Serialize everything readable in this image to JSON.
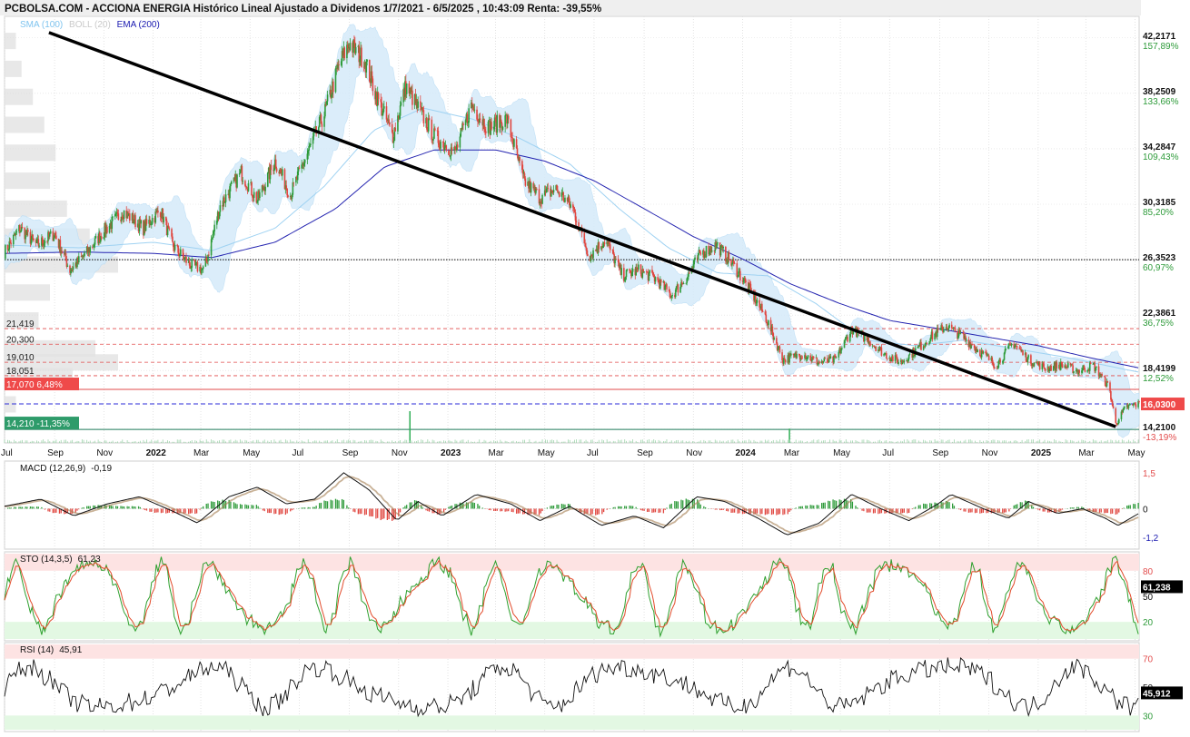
{
  "header": {
    "title": "PCBOLSA.COM - ACCIONA ENERGIA Histórico Lineal Ajustado a Dividenos 1/7/2021 - 6/5/2025 , 10:43:09 Renta: -39,55%"
  },
  "legend": {
    "sma": "SMA (100)",
    "boll": "BOLL (20)",
    "ema": "EMA (200)"
  },
  "colors": {
    "up": "#2e9b3a",
    "down": "#e0463f",
    "sma": "#9fd2f2",
    "boll_fill": "#d5ebfa",
    "ema": "#2424b0",
    "trend": "#000000",
    "grid": "#dcdcdc",
    "volume": "#2fae55"
  },
  "chart_data": [
    {
      "type": "candlestick",
      "title": "ACCIONA ENERGIA",
      "x_range": [
        "2021-07-01",
        "2025-05-06"
      ],
      "x_tick_labels": [
        "Jul",
        "Sep",
        "Nov",
        "2022",
        "Mar",
        "May",
        "Jul",
        "Sep",
        "Nov",
        "2023",
        "Mar",
        "May",
        "Jul",
        "Sep",
        "Nov",
        "2024",
        "Mar",
        "May",
        "Jul",
        "Sep",
        "Nov",
        "2025",
        "Mar",
        "May"
      ],
      "x_tick_dates": [
        "2021-07-01",
        "2021-09-01",
        "2021-11-01",
        "2022-01-01",
        "2022-03-01",
        "2022-05-01",
        "2022-07-01",
        "2022-09-01",
        "2022-11-01",
        "2023-01-01",
        "2023-03-01",
        "2023-05-01",
        "2023-07-01",
        "2023-09-01",
        "2023-11-01",
        "2024-01-01",
        "2024-03-01",
        "2024-05-01",
        "2024-07-01",
        "2024-09-01",
        "2024-11-01",
        "2025-01-01",
        "2025-03-01",
        "2025-05-01"
      ],
      "x_tick_bold": [
        "2022",
        "2023",
        "2024",
        "2025"
      ],
      "y_range": [
        13.5,
        43.5
      ],
      "y_ticks": [
        {
          "value": 42.2171,
          "label": "42,2171",
          "pct": "157,89%"
        },
        {
          "value": 38.2509,
          "label": "38,2509",
          "pct": "133,66%"
        },
        {
          "value": 34.2847,
          "label": "34,2847",
          "pct": "109,43%"
        },
        {
          "value": 30.3185,
          "label": "30,3185",
          "pct": "85,20%"
        },
        {
          "value": 26.3523,
          "label": "26,3523",
          "pct": "60,97%"
        },
        {
          "value": 22.3861,
          "label": "22,3861",
          "pct": "36,75%"
        },
        {
          "value": 18.4199,
          "label": "18,4199",
          "pct": "12,52%"
        },
        {
          "value": 14.21,
          "label": "14,2100",
          "pct": "-13,19%"
        }
      ],
      "last_price": {
        "value": 16.03,
        "label": "16,0300"
      },
      "reference_line": 26.3523,
      "resistance_levels": [
        {
          "value": 21.419,
          "label": "21,419"
        },
        {
          "value": 20.3,
          "label": "20,300"
        },
        {
          "value": 19.01,
          "label": "19,010"
        },
        {
          "value": 18.051,
          "label": "18,051"
        }
      ],
      "max_badge": {
        "value": 17.07,
        "label": "17,070",
        "pct": "6,48%"
      },
      "min_badge": {
        "value": 14.21,
        "label": "14,210",
        "pct": "-11,35%"
      },
      "trendline": [
        {
          "date": "2021-08-25",
          "value": 42.6
        },
        {
          "date": "2025-04-07",
          "value": 14.4
        }
      ],
      "price_path": [
        [
          "2021-07-01",
          26.9
        ],
        [
          "2021-07-20",
          28.6
        ],
        [
          "2021-08-10",
          27.4
        ],
        [
          "2021-09-01",
          28.2
        ],
        [
          "2021-09-20",
          25.6
        ],
        [
          "2021-10-10",
          26.8
        ],
        [
          "2021-11-01",
          28.4
        ],
        [
          "2021-11-25",
          29.8
        ],
        [
          "2021-12-20",
          28.6
        ],
        [
          "2022-01-10",
          29.9
        ],
        [
          "2022-01-25",
          27.4
        ],
        [
          "2022-02-15",
          26.0
        ],
        [
          "2022-03-05",
          25.6
        ],
        [
          "2022-03-25",
          30.2
        ],
        [
          "2022-04-20",
          32.6
        ],
        [
          "2022-05-10",
          30.6
        ],
        [
          "2022-06-01",
          33.4
        ],
        [
          "2022-06-20",
          31.0
        ],
        [
          "2022-07-10",
          33.8
        ],
        [
          "2022-08-01",
          36.8
        ],
        [
          "2022-08-20",
          40.4
        ],
        [
          "2022-09-01",
          41.8
        ],
        [
          "2022-09-20",
          40.6
        ],
        [
          "2022-10-05",
          38.0
        ],
        [
          "2022-10-25",
          35.2
        ],
        [
          "2022-11-10",
          38.8
        ],
        [
          "2022-11-25",
          37.2
        ],
        [
          "2022-12-15",
          35.2
        ],
        [
          "2023-01-10",
          34.0
        ],
        [
          "2023-01-30",
          37.4
        ],
        [
          "2023-02-20",
          35.8
        ],
        [
          "2023-03-15",
          36.4
        ],
        [
          "2023-04-05",
          32.0
        ],
        [
          "2023-04-25",
          30.8
        ],
        [
          "2023-05-15",
          31.4
        ],
        [
          "2023-06-05",
          30.0
        ],
        [
          "2023-06-25",
          26.6
        ],
        [
          "2023-07-15",
          27.8
        ],
        [
          "2023-08-05",
          25.2
        ],
        [
          "2023-08-25",
          25.6
        ],
        [
          "2023-09-15",
          25.0
        ],
        [
          "2023-10-05",
          23.8
        ],
        [
          "2023-10-25",
          25.2
        ],
        [
          "2023-11-10",
          26.8
        ],
        [
          "2023-11-30",
          27.4
        ],
        [
          "2023-12-20",
          26.0
        ],
        [
          "2024-01-10",
          24.2
        ],
        [
          "2024-01-30",
          22.2
        ],
        [
          "2024-02-20",
          19.2
        ],
        [
          "2024-03-15",
          19.6
        ],
        [
          "2024-04-05",
          19.0
        ],
        [
          "2024-04-25",
          19.2
        ],
        [
          "2024-05-15",
          21.4
        ],
        [
          "2024-06-05",
          20.6
        ],
        [
          "2024-06-25",
          19.6
        ],
        [
          "2024-07-15",
          19.0
        ],
        [
          "2024-08-05",
          20.0
        ],
        [
          "2024-08-25",
          21.0
        ],
        [
          "2024-09-10",
          21.6
        ],
        [
          "2024-09-30",
          20.8
        ],
        [
          "2024-10-20",
          19.8
        ],
        [
          "2024-11-10",
          18.8
        ],
        [
          "2024-12-01",
          20.4
        ],
        [
          "2024-12-20",
          19.2
        ],
        [
          "2025-01-10",
          18.6
        ],
        [
          "2025-01-30",
          18.8
        ],
        [
          "2025-02-20",
          18.4
        ],
        [
          "2025-03-10",
          18.8
        ],
        [
          "2025-03-30",
          17.2
        ],
        [
          "2025-04-07",
          14.6
        ],
        [
          "2025-04-20",
          15.8
        ],
        [
          "2025-05-06",
          16.03
        ]
      ],
      "ema200_path": [
        [
          "2021-07-01",
          26.8
        ],
        [
          "2021-10-01",
          26.9
        ],
        [
          "2022-01-01",
          26.8
        ],
        [
          "2022-03-15",
          26.5
        ],
        [
          "2022-06-01",
          27.6
        ],
        [
          "2022-08-15",
          30.0
        ],
        [
          "2022-10-15",
          33.0
        ],
        [
          "2022-12-15",
          34.2
        ],
        [
          "2023-03-01",
          34.2
        ],
        [
          "2023-05-01",
          33.4
        ],
        [
          "2023-07-01",
          32.0
        ],
        [
          "2023-09-01",
          30.0
        ],
        [
          "2023-11-01",
          28.0
        ],
        [
          "2024-01-01",
          26.4
        ],
        [
          "2024-03-01",
          24.6
        ],
        [
          "2024-05-01",
          23.2
        ],
        [
          "2024-07-01",
          22.0
        ],
        [
          "2024-09-01",
          21.4
        ],
        [
          "2024-11-01",
          20.8
        ],
        [
          "2025-01-01",
          20.2
        ],
        [
          "2025-03-01",
          19.4
        ],
        [
          "2025-05-06",
          18.6
        ]
      ],
      "sma100_path": [
        [
          "2021-07-01",
          27.4
        ],
        [
          "2021-10-01",
          27.2
        ],
        [
          "2022-01-01",
          27.6
        ],
        [
          "2022-03-15",
          27.0
        ],
        [
          "2022-06-01",
          28.6
        ],
        [
          "2022-08-01",
          31.6
        ],
        [
          "2022-10-01",
          35.6
        ],
        [
          "2022-12-01",
          37.2
        ],
        [
          "2023-02-01",
          36.4
        ],
        [
          "2023-04-01",
          35.0
        ],
        [
          "2023-06-01",
          33.2
        ],
        [
          "2023-08-01",
          30.0
        ],
        [
          "2023-10-01",
          27.2
        ],
        [
          "2023-12-01",
          25.4
        ],
        [
          "2024-02-01",
          25.2
        ],
        [
          "2024-04-01",
          23.2
        ],
        [
          "2024-06-01",
          20.6
        ],
        [
          "2024-08-01",
          20.2
        ],
        [
          "2024-10-01",
          20.6
        ],
        [
          "2024-12-01",
          20.0
        ],
        [
          "2025-02-01",
          19.4
        ],
        [
          "2025-05-06",
          18.3
        ]
      ],
      "volume_spikes": [
        {
          "date": "2022-11-15",
          "relative": 1.0
        },
        {
          "date": "2024-02-28",
          "relative": 0.45
        }
      ],
      "volume_profile": [
        {
          "price": 42.0,
          "relative": 0.1
        },
        {
          "price": 40.0,
          "relative": 0.15
        },
        {
          "price": 38.0,
          "relative": 0.25
        },
        {
          "price": 36.0,
          "relative": 0.35
        },
        {
          "price": 34.0,
          "relative": 0.45
        },
        {
          "price": 32.0,
          "relative": 0.4
        },
        {
          "price": 30.0,
          "relative": 0.55
        },
        {
          "price": 28.0,
          "relative": 0.75
        },
        {
          "price": 26.0,
          "relative": 1.0
        },
        {
          "price": 24.0,
          "relative": 0.4
        },
        {
          "price": 22.0,
          "relative": 0.3
        },
        {
          "price": 20.0,
          "relative": 0.8
        },
        {
          "price": 19.0,
          "relative": 1.0
        },
        {
          "price": 18.0,
          "relative": 0.6
        },
        {
          "price": 16.0,
          "relative": 0.1
        }
      ]
    },
    {
      "type": "line",
      "title": "MACD (12,26,9)",
      "current": "-0,19",
      "y_range": [
        -1.5,
        1.8
      ],
      "y_ticks": [
        {
          "value": 1.5,
          "label": "1,5"
        },
        {
          "value": 0,
          "label": "0"
        },
        {
          "value": -1.2,
          "label": "-1,2"
        }
      ],
      "series_path": [
        [
          "2021-07-01",
          0.1
        ],
        [
          "2021-08-15",
          0.4
        ],
        [
          "2021-09-25",
          -0.3
        ],
        [
          "2021-11-05",
          0.2
        ],
        [
          "2021-12-15",
          0.5
        ],
        [
          "2022-01-25",
          -0.1
        ],
        [
          "2022-02-25",
          -0.6
        ],
        [
          "2022-04-05",
          0.5
        ],
        [
          "2022-05-10",
          0.9
        ],
        [
          "2022-06-15",
          0.2
        ],
        [
          "2022-07-20",
          0.4
        ],
        [
          "2022-08-25",
          1.5
        ],
        [
          "2022-09-25",
          0.8
        ],
        [
          "2022-10-30",
          -0.5
        ],
        [
          "2022-11-25",
          0.3
        ],
        [
          "2022-12-25",
          -0.3
        ],
        [
          "2023-02-05",
          0.6
        ],
        [
          "2023-03-20",
          0.2
        ],
        [
          "2023-04-25",
          -0.5
        ],
        [
          "2023-06-01",
          0.1
        ],
        [
          "2023-07-10",
          -0.7
        ],
        [
          "2023-08-20",
          -0.3
        ],
        [
          "2023-09-25",
          -0.8
        ],
        [
          "2023-11-05",
          0.5
        ],
        [
          "2023-12-10",
          0.3
        ],
        [
          "2024-01-20",
          -0.4
        ],
        [
          "2024-02-25",
          -1.1
        ],
        [
          "2024-04-05",
          -0.6
        ],
        [
          "2024-05-15",
          0.6
        ],
        [
          "2024-06-20",
          0.0
        ],
        [
          "2024-07-25",
          -0.5
        ],
        [
          "2024-08-30",
          0.2
        ],
        [
          "2024-09-15",
          0.6
        ],
        [
          "2024-10-25",
          0.0
        ],
        [
          "2024-11-25",
          -0.4
        ],
        [
          "2024-12-20",
          0.3
        ],
        [
          "2025-01-25",
          -0.2
        ],
        [
          "2025-02-25",
          0.0
        ],
        [
          "2025-03-25",
          -0.4
        ],
        [
          "2025-04-10",
          -0.7
        ],
        [
          "2025-05-06",
          -0.19
        ]
      ]
    },
    {
      "type": "line",
      "title": "STO (14,3,5)",
      "current": "61,23",
      "last_label": "61,238",
      "y_range": [
        0,
        100
      ],
      "y_ticks": [
        {
          "value": 80,
          "label": "80"
        },
        {
          "value": 50,
          "label": "50"
        },
        {
          "value": 20,
          "label": "20"
        }
      ],
      "overbought": 80,
      "oversold": 20
    },
    {
      "type": "line",
      "title": "RSI (14)",
      "current": "45,91",
      "last_label": "45,912",
      "y_range": [
        20,
        80
      ],
      "y_ticks": [
        {
          "value": 70,
          "label": "70"
        },
        {
          "value": 50,
          "label": "50"
        },
        {
          "value": 30,
          "label": "30"
        }
      ],
      "overbought": 70,
      "oversold": 30
    }
  ]
}
